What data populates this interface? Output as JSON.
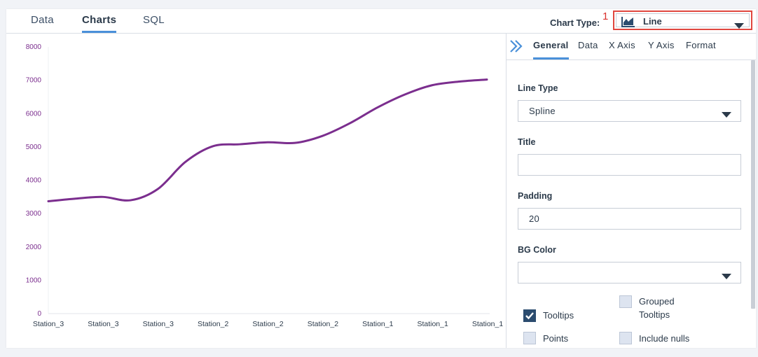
{
  "tabs": [
    {
      "label": "Data",
      "active": false
    },
    {
      "label": "Charts",
      "active": true
    },
    {
      "label": "SQL",
      "active": false
    }
  ],
  "chart_type": {
    "label": "Chart Type:",
    "value": "Line",
    "annotation": "1"
  },
  "side_tabs": [
    {
      "label": "General",
      "active": true
    },
    {
      "label": "Data",
      "active": false
    },
    {
      "label": "X Axis",
      "active": false
    },
    {
      "label": "Y Axis",
      "active": false
    },
    {
      "label": "Format",
      "active": false
    }
  ],
  "settings": {
    "line_type": {
      "label": "Line Type",
      "value": "Spline"
    },
    "title": {
      "label": "Title",
      "value": ""
    },
    "padding": {
      "label": "Padding",
      "value": "20"
    },
    "bg_color": {
      "label": "BG Color",
      "value": ""
    },
    "checkboxes": [
      {
        "label": "Tooltips",
        "checked": true
      },
      {
        "label": "Grouped Tooltips",
        "checked": false
      },
      {
        "label": "Points",
        "checked": false
      },
      {
        "label": "Include nulls",
        "checked": false
      }
    ]
  },
  "colors": {
    "line": "#7b2e8e",
    "accent": "#4a90d9",
    "annotation": "#e0473f",
    "checkbox_checked": "#2b4c6f"
  },
  "chart_data": {
    "type": "line",
    "curve": "spline",
    "categories": [
      "Station_3",
      "Station_3",
      "Station_3",
      "Station_2",
      "Station_2",
      "Station_2",
      "Station_1",
      "Station_1",
      "Station_1"
    ],
    "x_count": 23,
    "values": [
      3370,
      3450,
      3500,
      3400,
      3740,
      4550,
      5020,
      5080,
      5140,
      5120,
      5330,
      5710,
      6180,
      6570,
      6850,
      6960,
      7020
    ],
    "y_ticks": [
      "0",
      "1000",
      "2000",
      "3000",
      "4000",
      "5000",
      "6000",
      "7000",
      "8000"
    ],
    "ylim": [
      0,
      8000
    ],
    "grid": false,
    "legend": false
  }
}
